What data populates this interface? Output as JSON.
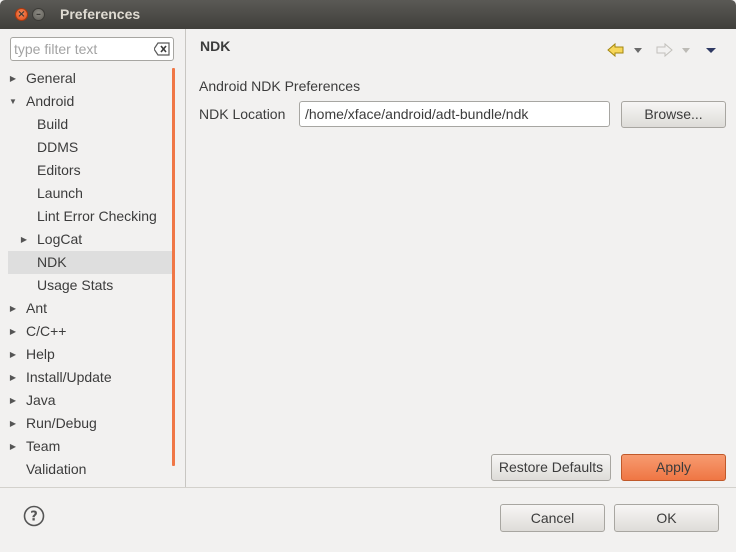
{
  "window": {
    "title": "Preferences"
  },
  "filter": {
    "placeholder": "type filter text",
    "value": ""
  },
  "tree": [
    {
      "label": "General",
      "level": 0,
      "expander": "collapsed",
      "selected": false
    },
    {
      "label": "Android",
      "level": 0,
      "expander": "expanded",
      "selected": false
    },
    {
      "label": "Build",
      "level": 1,
      "expander": "none",
      "selected": false
    },
    {
      "label": "DDMS",
      "level": 1,
      "expander": "none",
      "selected": false
    },
    {
      "label": "Editors",
      "level": 1,
      "expander": "none",
      "selected": false
    },
    {
      "label": "Launch",
      "level": 1,
      "expander": "none",
      "selected": false
    },
    {
      "label": "Lint Error Checking",
      "level": 1,
      "expander": "none",
      "selected": false
    },
    {
      "label": "LogCat",
      "level": 1,
      "expander": "collapsed",
      "selected": false
    },
    {
      "label": "NDK",
      "level": 1,
      "expander": "none",
      "selected": true
    },
    {
      "label": "Usage Stats",
      "level": 1,
      "expander": "none",
      "selected": false
    },
    {
      "label": "Ant",
      "level": 0,
      "expander": "collapsed",
      "selected": false
    },
    {
      "label": "C/C++",
      "level": 0,
      "expander": "collapsed",
      "selected": false
    },
    {
      "label": "Help",
      "level": 0,
      "expander": "collapsed",
      "selected": false
    },
    {
      "label": "Install/Update",
      "level": 0,
      "expander": "collapsed",
      "selected": false
    },
    {
      "label": "Java",
      "level": 0,
      "expander": "collapsed",
      "selected": false
    },
    {
      "label": "Run/Debug",
      "level": 0,
      "expander": "collapsed",
      "selected": false
    },
    {
      "label": "Team",
      "level": 0,
      "expander": "collapsed",
      "selected": false
    },
    {
      "label": "Validation",
      "level": 0,
      "expander": "none",
      "selected": false
    }
  ],
  "page": {
    "title": "NDK",
    "section": "Android NDK Preferences",
    "ndk_location_label": "NDK Location",
    "ndk_location_value": "/home/xface/android/adt-bundle/ndk",
    "browse_label": "Browse...",
    "restore_defaults_label": "Restore Defaults",
    "apply_label": "Apply"
  },
  "dialog": {
    "cancel_label": "Cancel",
    "ok_label": "OK"
  },
  "colors": {
    "accent": "#f07746",
    "selected_row": "#dedede",
    "titlebar": "#403f3b"
  },
  "icons": {
    "back": "back-arrow-icon",
    "forward": "forward-arrow-icon",
    "menu": "view-menu-icon",
    "help": "help-icon",
    "clear": "clear-filter-icon"
  }
}
